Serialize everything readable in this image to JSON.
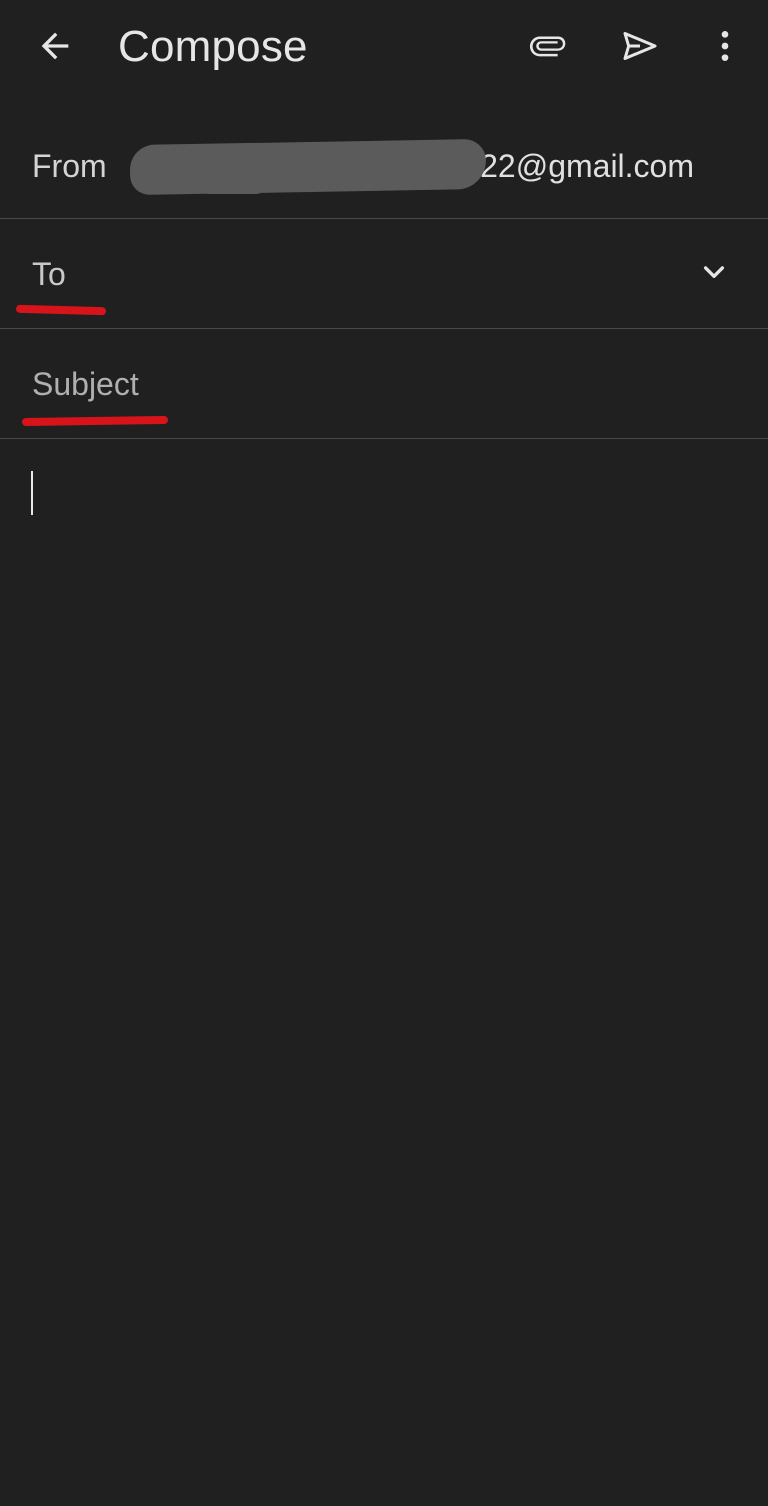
{
  "appbar": {
    "title": "Compose",
    "back_icon": "arrow-back-icon",
    "attach_icon": "paperclip-icon",
    "send_icon": "send-icon",
    "more_icon": "more-vertical-icon"
  },
  "from": {
    "label": "From",
    "value": "22@gmail.com"
  },
  "to": {
    "label": "To",
    "value": "",
    "expand_icon": "chevron-down-icon"
  },
  "subject": {
    "label": "Subject",
    "value": ""
  },
  "body": {
    "value": ""
  },
  "colors": {
    "background": "#202020",
    "divider": "#4a4a4a",
    "annotation": "#d8141b"
  }
}
